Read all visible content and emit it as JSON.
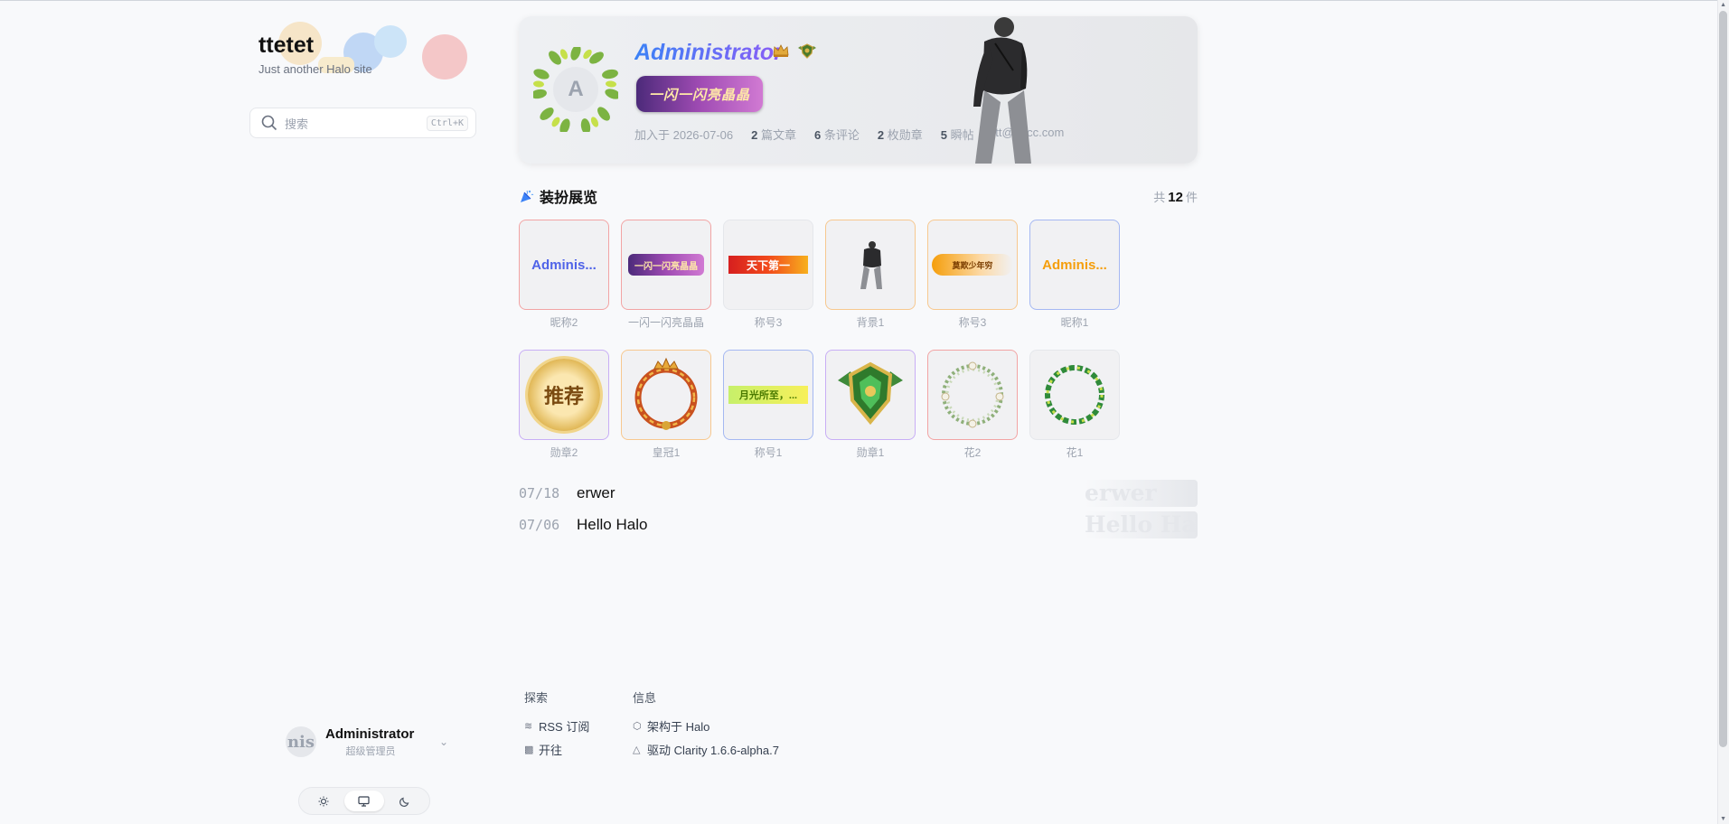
{
  "site": {
    "title": "ttetet",
    "subtitle": "Just another Halo site"
  },
  "search": {
    "placeholder": "搜索",
    "shortcut": "Ctrl+K"
  },
  "user_menu": {
    "name": "Administrator",
    "role": "超级管理员",
    "avatar_text": "nis"
  },
  "theme": {
    "modes": [
      "light",
      "system",
      "dark"
    ],
    "active": "system"
  },
  "profile": {
    "avatar_letter": "A",
    "name": "Administrator",
    "banner_title": "一闪一闪亮晶晶",
    "stats": {
      "joined_label": "加入于 2026-07-06",
      "posts_num": "2",
      "posts_label": "篇文章",
      "comments_num": "6",
      "comments_label": "条评论",
      "badges_num": "2",
      "badges_label": "枚勋章",
      "moments_num": "5",
      "moments_label": "瞬帖",
      "email": "ttt@qqcc.com"
    }
  },
  "showcase": {
    "title": "装扮展览",
    "count_prefix": "共",
    "count": "12",
    "count_suffix": "件",
    "items": [
      {
        "label": "昵称2",
        "kind": "nick",
        "text": "Adminis...",
        "color": "#4f63e8",
        "border": "red"
      },
      {
        "label": "一闪一闪亮晶晶",
        "kind": "banner",
        "text": "一闪一闪亮晶晶",
        "border": "red"
      },
      {
        "label": "称号3",
        "kind": "title-red",
        "text": "天下第一",
        "border": "gray"
      },
      {
        "label": "背景1",
        "kind": "figure",
        "border": "orange"
      },
      {
        "label": "称号3",
        "kind": "title-gold",
        "text": "莫欺少年穷",
        "border": "orange"
      },
      {
        "label": "昵称1",
        "kind": "nick",
        "text": "Adminis...",
        "color": "#f59e0b",
        "border": "blue"
      },
      {
        "label": "勋章2",
        "kind": "seal",
        "text": "推荐",
        "border": "purple"
      },
      {
        "label": "皇冠1",
        "kind": "crown-ring",
        "border": "orange"
      },
      {
        "label": "称号1",
        "kind": "title-yellow",
        "text": "月光所至，...",
        "border": "blue"
      },
      {
        "label": "勋章1",
        "kind": "emblem",
        "border": "purple"
      },
      {
        "label": "花2",
        "kind": "flower-ring",
        "border": "red"
      },
      {
        "label": "花1",
        "kind": "leaf-ring",
        "border": "gray"
      }
    ]
  },
  "posts": [
    {
      "date": "07/18",
      "title": "erwer"
    },
    {
      "date": "07/06",
      "title": "Hello Halo"
    }
  ],
  "footer": {
    "explore": {
      "heading": "探索",
      "rss": "RSS 订阅",
      "open": "开往"
    },
    "info": {
      "heading": "信息",
      "halo": "架构于 Halo",
      "clarity": "驱动 Clarity 1.6.6-alpha.7"
    }
  },
  "colors": {
    "accent": "#3b82f6",
    "nick_gradient_start": "#3b82f6",
    "nick_gradient_end": "#8b5cf6"
  }
}
